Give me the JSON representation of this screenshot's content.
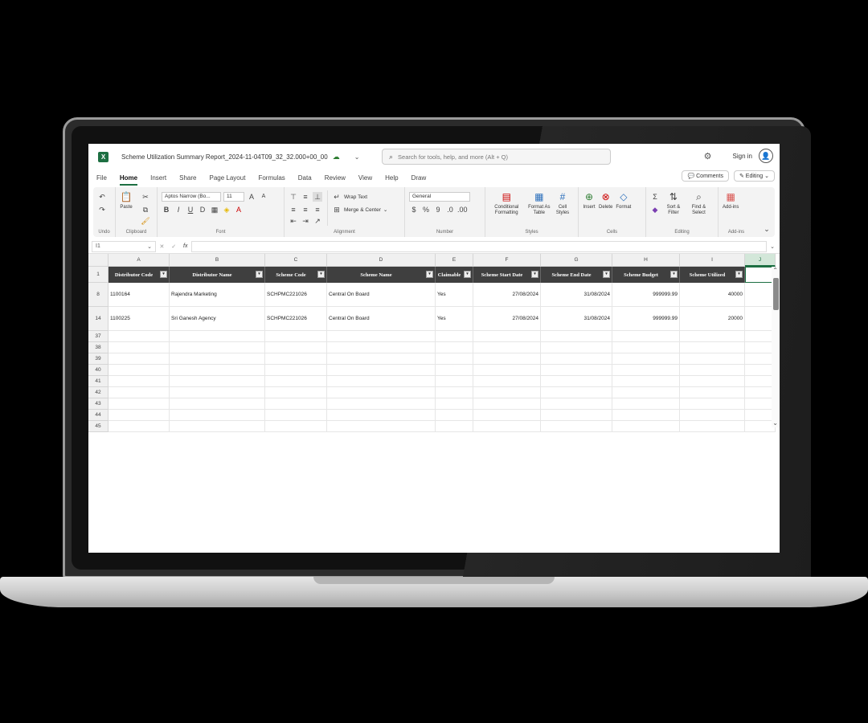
{
  "app": {
    "title": "Scheme Utilization Summary Report_2024-11-04T09_32_32.000+00_00",
    "icon_letter": "X",
    "search_placeholder": "Search for tools, help, and more (Alt + Q)",
    "sign_in": "Sign in"
  },
  "menu": {
    "tabs": [
      "File",
      "Home",
      "Insert",
      "Share",
      "Page Layout",
      "Formulas",
      "Data",
      "Review",
      "View",
      "Help",
      "Draw"
    ],
    "active": "Home",
    "comments": "Comments",
    "editing": "Editing"
  },
  "ribbon": {
    "undo": "Undo",
    "paste": "Paste",
    "clipboard": "Clipboard",
    "font_name": "Aptos Narrow (Bo...",
    "font_size": "11",
    "font": "Font",
    "wrap_text": "Wrap Text",
    "merge_center": "Merge & Center",
    "alignment": "Alignment",
    "number_format": "General",
    "number": "Number",
    "conditional_formatting": "Conditional Formatting",
    "format_as_table": "Format As Table",
    "cell_styles": "Cell Styles",
    "styles": "Styles",
    "insert": "Insert",
    "delete": "Delete",
    "format": "Format",
    "cells": "Cells",
    "sort_filter": "Sort & Filter",
    "find_select": "Find & Select",
    "editing": "Editing",
    "addins": "Add-ins",
    "addins_group": "Add-ins"
  },
  "formula_bar": {
    "name_box": "I1",
    "value": ""
  },
  "sheet": {
    "columns": [
      "A",
      "B",
      "C",
      "D",
      "E",
      "F",
      "G",
      "H",
      "I",
      "J"
    ],
    "selected_column": "J",
    "headers": [
      "Distributor Code",
      "Distributor Name",
      "Scheme Code",
      "Scheme Name",
      "Claimable",
      "Scheme Start Date",
      "Scheme End Date",
      "Scheme Budget",
      "Scheme Utilized"
    ],
    "header_row_number": "1",
    "rows": [
      {
        "num": "8",
        "cells": [
          "1100164",
          "Rajendra Marketing",
          "SCHPMC221026",
          "Central On Board",
          "Yes",
          "27/08/2024",
          "31/08/2024",
          "999999.99",
          "40000"
        ]
      },
      {
        "num": "14",
        "cells": [
          "1100225",
          "Sri Ganesh Agency",
          "SCHPMC221026",
          "Central On Board",
          "Yes",
          "27/08/2024",
          "31/08/2024",
          "999999.99",
          "20000"
        ]
      }
    ],
    "empty_rows": [
      "37",
      "38",
      "39",
      "40",
      "41",
      "42",
      "43",
      "44",
      "45"
    ]
  }
}
